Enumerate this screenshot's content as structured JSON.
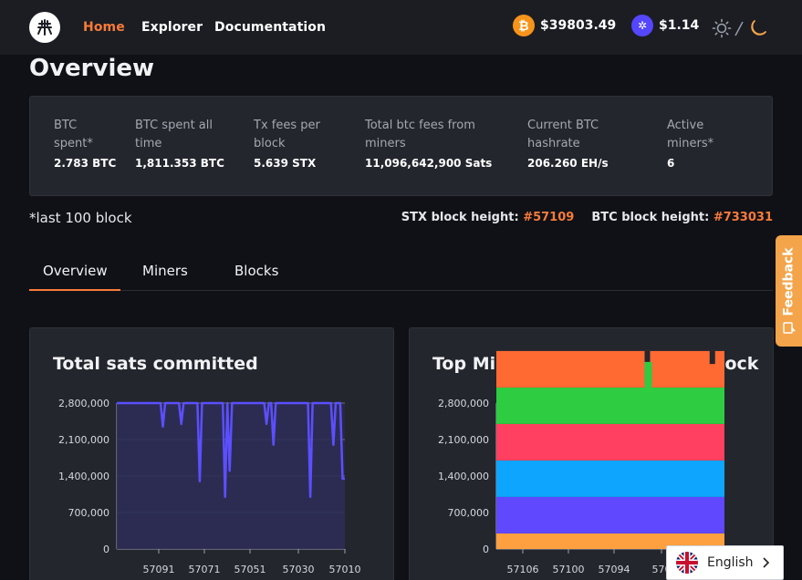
{
  "nav": {
    "links": [
      "Home",
      "Explorer",
      "Documentation"
    ],
    "btc_price": "$39803.49",
    "stx_price": "$1.14",
    "btc_coin_glyph": "₿",
    "stx_coin_glyph": "✲"
  },
  "overview": {
    "title": "Overview",
    "stats": [
      {
        "label": "BTC spent*",
        "value": "2.783 BTC"
      },
      {
        "label": "BTC spent all time",
        "value": "1,811.353 BTC"
      },
      {
        "label": "Tx fees per block",
        "value": "5.639 STX"
      },
      {
        "label": "Total btc fees from miners",
        "value": "11,096,642,900 Sats"
      },
      {
        "label": "Current BTC hashrate",
        "value": "206.260 EH/s"
      },
      {
        "label": "Active miners*",
        "value": "6"
      }
    ],
    "note": "*last 100 block",
    "stx_height_label": "STX block height:",
    "stx_height_value": "#57109",
    "btc_height_label": "BTC block height:",
    "btc_height_value": "#733031"
  },
  "tabs": [
    "Overview",
    "Miners",
    "Blocks"
  ],
  "charts": {
    "chart1_title": "Total sats committed",
    "chart2_title": "Top Miners - Sats spent per block"
  },
  "feedback_label": "Feedback",
  "language": "English",
  "colors": {
    "accent": "#f97b39",
    "line_series": "#5b4fff",
    "stack": [
      "#ffa040",
      "#6048ff",
      "#0ea5ff",
      "#ff4060",
      "#2ecc40",
      "#ff6a33"
    ]
  },
  "chart_data": [
    {
      "type": "area",
      "title": "Total sats committed",
      "xlabel": "",
      "ylabel": "",
      "ylim": [
        0,
        2800000
      ],
      "yticks": [
        "2,800,000",
        "2,100,000",
        "1,400,000",
        "700,000",
        "0"
      ],
      "xticks": [
        "57091",
        "57071",
        "57051",
        "57030",
        "57010"
      ],
      "values": [
        2800000,
        2800000,
        2800000,
        2800000,
        2800000,
        2800000,
        2800000,
        2800000,
        2800000,
        2800000,
        2800000,
        2800000,
        2800000,
        2800000,
        2800000,
        2800000,
        2800000,
        2800000,
        2800000,
        2800000,
        2350000,
        2800000,
        2800000,
        2800000,
        2800000,
        2800000,
        2800000,
        2800000,
        2400000,
        2800000,
        2800000,
        2800000,
        2800000,
        2800000,
        2800000,
        2800000,
        1300000,
        2800000,
        2800000,
        2800000,
        2800000,
        2800000,
        2800000,
        2800000,
        2800000,
        2800000,
        2800000,
        1000000,
        2800000,
        1500000,
        2800000,
        2800000,
        2800000,
        2800000,
        2800000,
        2800000,
        2800000,
        2800000,
        2800000,
        2800000,
        2800000,
        2800000,
        2800000,
        2800000,
        2800000,
        2400000,
        2800000,
        2800000,
        2000000,
        2800000,
        2800000,
        2800000,
        2800000,
        2800000,
        2800000,
        2800000,
        2800000,
        2800000,
        2800000,
        2800000,
        2800000,
        2800000,
        2800000,
        2800000,
        1000000,
        2800000,
        2800000,
        2800000,
        2800000,
        2800000,
        2800000,
        2800000,
        2800000,
        2800000,
        2000000,
        2800000,
        2800000,
        2800000,
        1350000,
        1350000
      ],
      "grid": true
    },
    {
      "type": "bar",
      "title": "Top Miners - Sats spent per block",
      "stacked": true,
      "ylim": [
        0,
        2800000
      ],
      "yticks": [
        "2,800,000",
        "2,100,000",
        "1,400,000",
        "700,000",
        "0"
      ],
      "xticks": [
        "57106",
        "57100",
        "57094",
        "570"
      ],
      "series": [
        {
          "values_each": 300000
        },
        {
          "values_each": 700000
        },
        {
          "values_each": 700000
        },
        {
          "values_each": 700000
        },
        {
          "values_each": 700000
        },
        {
          "values_each": 700000
        }
      ],
      "gaps_in_top_series_at_fraction": [
        0.65,
        0.935
      ]
    }
  ]
}
